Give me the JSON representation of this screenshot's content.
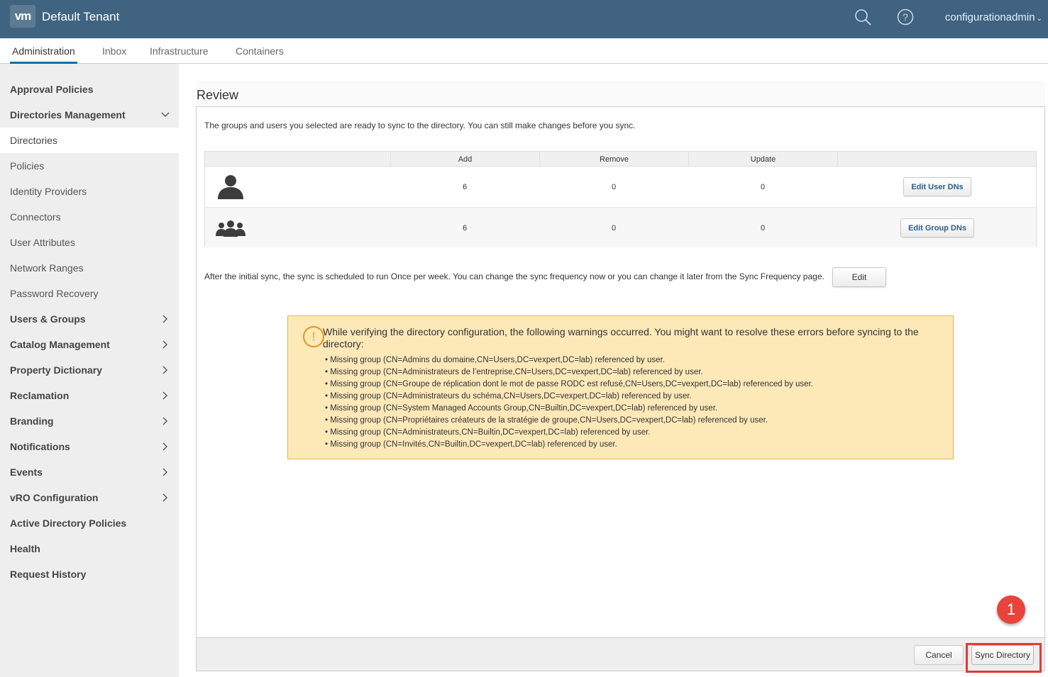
{
  "header": {
    "logo_text": "vm",
    "tenant": "Default Tenant",
    "user": "configurationadmin",
    "bg_color": "#3f6381"
  },
  "tabs": [
    {
      "label": "Administration",
      "active": true
    },
    {
      "label": "Inbox"
    },
    {
      "label": "Infrastructure"
    },
    {
      "label": "Containers"
    }
  ],
  "sidebar": {
    "items": [
      {
        "label": "Approval Policies"
      },
      {
        "label": "Directories Management",
        "expanded": true
      },
      {
        "label": "Directories",
        "selected": true
      },
      {
        "label": "Policies"
      },
      {
        "label": "Identity Providers"
      },
      {
        "label": "Connectors"
      },
      {
        "label": "User Attributes"
      },
      {
        "label": "Network Ranges"
      },
      {
        "label": "Password Recovery"
      },
      {
        "label": "Users & Groups"
      },
      {
        "label": "Catalog Management"
      },
      {
        "label": "Property Dictionary"
      },
      {
        "label": "Reclamation"
      },
      {
        "label": "Branding"
      },
      {
        "label": "Notifications"
      },
      {
        "label": "Events"
      },
      {
        "label": "vRO Configuration"
      },
      {
        "label": "Active Directory Policies"
      },
      {
        "label": "Health"
      },
      {
        "label": "Request History"
      }
    ]
  },
  "review": {
    "title": "Review",
    "intro": "The groups and users you selected are ready to sync to the directory. You can still make changes before you sync.",
    "columns": [
      "Add",
      "Remove",
      "Update"
    ],
    "rows": [
      {
        "icon": "user-icon",
        "add": "6",
        "remove": "0",
        "update": "0",
        "action": "Edit User DNs"
      },
      {
        "icon": "group-icon",
        "add": "6",
        "remove": "0",
        "update": "0",
        "action": "Edit Group DNs"
      }
    ],
    "frequency_text": "After the initial sync, the sync is scheduled to run Once per week. You can change the sync frequency now or you can change it later from the Sync Frequency page.",
    "edit_label": "Edit"
  },
  "warning": {
    "icon": "!",
    "title": "While verifying the directory configuration, the following warnings occurred. You might want to resolve these errors before syncing to the directory:",
    "items": [
      "Missing group (CN=Admins du domaine,CN=Users,DC=vexpert,DC=lab) referenced by user.",
      "Missing group (CN=Administrateurs de l’entreprise,CN=Users,DC=vexpert,DC=lab) referenced by user.",
      "Missing group (CN=Groupe de réplication dont le mot de passe RODC est refusé,CN=Users,DC=vexpert,DC=lab) referenced by user.",
      "Missing group (CN=Administrateurs du schéma,CN=Users,DC=vexpert,DC=lab) referenced by user.",
      "Missing group (CN=System Managed Accounts Group,CN=Builtin,DC=vexpert,DC=lab) referenced by user.",
      "Missing group (CN=Propriétaires créateurs de la stratégie de groupe,CN=Users,DC=vexpert,DC=lab) referenced by user.",
      "Missing group (CN=Administrateurs,CN=Builtin,DC=vexpert,DC=lab) referenced by user.",
      "Missing group (CN=Invités,CN=Builtin,DC=vexpert,DC=lab) referenced by user."
    ]
  },
  "footer": {
    "cancel_label": "Cancel",
    "sync_label": "Sync Directory"
  },
  "annotation": {
    "step": "1",
    "color": "#e8443b"
  }
}
